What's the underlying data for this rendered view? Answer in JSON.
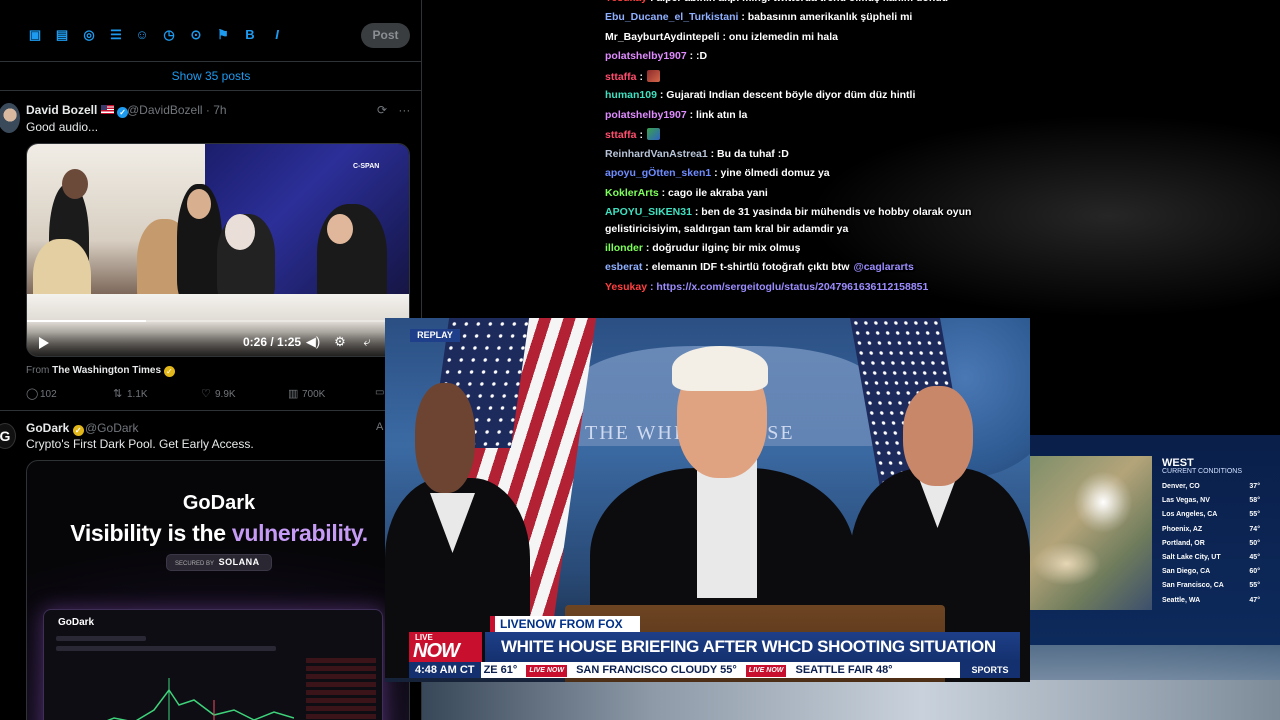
{
  "twitter": {
    "composer_tools": [
      "image-icon",
      "gif-icon",
      "grok-icon",
      "poll-icon",
      "emoji-icon",
      "schedule-icon",
      "location-icon",
      "flag-icon",
      "bold-icon",
      "italic-icon"
    ],
    "post_label": "Post",
    "show_posts": "Show 35 posts",
    "tweet1": {
      "name": "David Bozell",
      "handle": "@DavidBozell",
      "time": "· 7h",
      "text": "Good audio...",
      "video_time": "0:26 / 1:25",
      "video_progress": 0.31,
      "source_network": "C-SPAN",
      "from_label": "From",
      "from_source": "The Washington Times",
      "replies": "102",
      "reposts": "1.1K",
      "likes": "9.9K",
      "views": "700K"
    },
    "tweet2": {
      "name": "GoDark",
      "handle": "@GoDark",
      "text": "Crypto's First Dark Pool. Get Early Access.",
      "ad_label": "A",
      "brand": "GoDark",
      "headline_a": "Visibility is the",
      "headline_b": "vulnerability.",
      "secured_by": "SECURED BY",
      "secured_brand": "SOLANA"
    }
  },
  "chat": [
    {
      "user": "Yesukay",
      "msg": ": alper abinin akpi mingi twitterda trend olmuş kanim dondu",
      "color": "#ff4040"
    },
    {
      "user": "Ebu_Ducane_el_Turkistani",
      "msg": ": babasının amerikanlık şüpheli mi",
      "color": "#8fb0ff"
    },
    {
      "user": "Mr_BayburtAydintepeli",
      "msg": ": onu izlemedin mi hala",
      "color": "#ffffff"
    },
    {
      "user": "polatshelby1907",
      "msg": ": :D",
      "color": "#e08bff"
    },
    {
      "user": "sttaffa",
      "msg": ":",
      "color": "#ff4d6d"
    },
    {
      "user": "human109",
      "msg": ": Gujarati Indian descent böyle diyor düm düz hintli",
      "color": "#40e0c0"
    },
    {
      "user": "polatshelby1907",
      "msg": ": link atın la",
      "color": "#e08bff"
    },
    {
      "user": "sttaffa",
      "msg": ":",
      "color": "#ff4d6d"
    },
    {
      "user": "ReinhardVanAstrea1",
      "msg": ": Bu da tuhaf :D",
      "color": "#b8c4d8"
    },
    {
      "user": "apoyu_gÖtten_sken1",
      "msg": ": yine ölmedi domuz ya",
      "color": "#6e8cff"
    },
    {
      "user": "KoklerArts",
      "msg": ": cago ile akraba yani",
      "color": "#7dff5a"
    },
    {
      "user": "APOYU_SIKEN31",
      "msg": ": ben de 31 yasinda bir mühendis ve hobby olarak oyun",
      "color": "#40e0c0"
    },
    {
      "user": "",
      "msg": "gelistiricisiyim, saldırgan tam kral bir adamdir ya",
      "color": "#ffffff"
    },
    {
      "user": "illonder",
      "msg": ": doğrudur ilginç bir mix olmuş",
      "color": "#7dff5a"
    },
    {
      "user": "esberat",
      "msg": ": elemanın IDF t-shirtlü fotoğrafı çıktı btw",
      "color": "#8fb0ff",
      "mention": "@caglararts"
    },
    {
      "user": "Yesukay",
      "msg": ": https://x.com/sergeitoglu/status/2047961636112158851",
      "color": "#ff4040"
    }
  ],
  "news": {
    "replay": "REPLAY",
    "tag": "LIVENOW FROM FOX",
    "live_top": "LIVE",
    "live_now": "NOW",
    "headline": "WHITE HOUSE BRIEFING AFTER WHCD SHOOTING SITUATION",
    "backdrop_text": "THE WHITE HOUSE",
    "ticker_time": "4:48 AM CT",
    "ticker_items": [
      "ZE 61°",
      "SAN FRANCISCO CLOUDY 55°",
      "SEATTLE FAIR 48°"
    ],
    "ticker_logo": "LIVE NOW",
    "sports": "SPORTS"
  },
  "weather": {
    "title": "WEST",
    "subtitle": "CURRENT CONDITIONS",
    "cities": [
      {
        "city": "Denver, CO",
        "temp": "37°"
      },
      {
        "city": "Las Vegas, NV",
        "temp": "58°"
      },
      {
        "city": "Los Angeles, CA",
        "temp": "55°"
      },
      {
        "city": "Phoenix, AZ",
        "temp": "74°"
      },
      {
        "city": "Portland, OR",
        "temp": "50°"
      },
      {
        "city": "Salt Lake City, UT",
        "temp": "45°"
      },
      {
        "city": "San Diego, CA",
        "temp": "60°"
      },
      {
        "city": "San Francisco, CA",
        "temp": "55°"
      },
      {
        "city": "Seattle, WA",
        "temp": "47°"
      }
    ]
  }
}
